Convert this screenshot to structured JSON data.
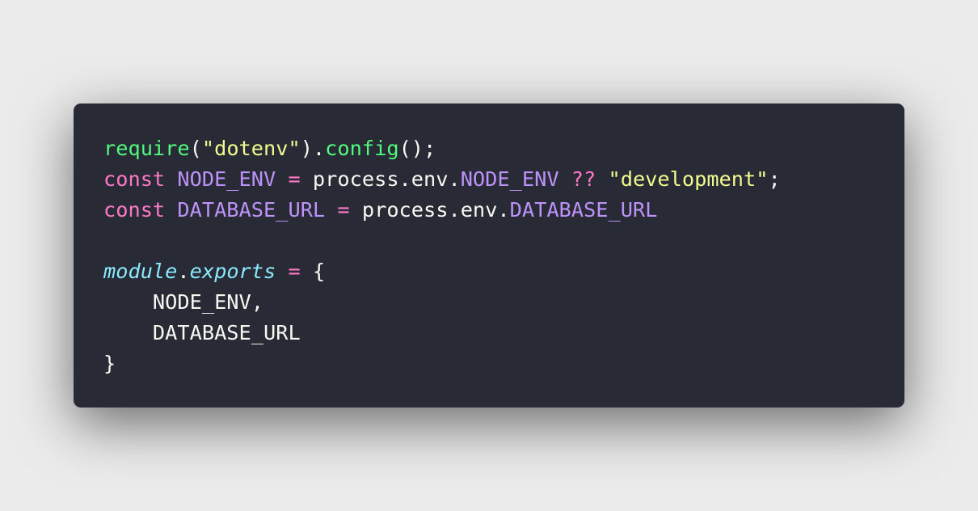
{
  "code": {
    "lines": [
      [
        {
          "text": "require",
          "kind": "fn"
        },
        {
          "text": "(",
          "kind": "plain"
        },
        {
          "text": "\"dotenv\"",
          "kind": "str"
        },
        {
          "text": ").",
          "kind": "plain"
        },
        {
          "text": "config",
          "kind": "fn"
        },
        {
          "text": "();",
          "kind": "plain"
        }
      ],
      [
        {
          "text": "const",
          "kind": "kw"
        },
        {
          "text": " ",
          "kind": "plain"
        },
        {
          "text": "NODE_ENV",
          "kind": "var"
        },
        {
          "text": " ",
          "kind": "plain"
        },
        {
          "text": "=",
          "kind": "kw"
        },
        {
          "text": " process.env.",
          "kind": "plain"
        },
        {
          "text": "NODE_ENV",
          "kind": "var"
        },
        {
          "text": " ",
          "kind": "plain"
        },
        {
          "text": "??",
          "kind": "kw"
        },
        {
          "text": " ",
          "kind": "plain"
        },
        {
          "text": "\"development\"",
          "kind": "str"
        },
        {
          "text": ";",
          "kind": "plain"
        }
      ],
      [
        {
          "text": "const",
          "kind": "kw"
        },
        {
          "text": " ",
          "kind": "plain"
        },
        {
          "text": "DATABASE_URL",
          "kind": "var"
        },
        {
          "text": " ",
          "kind": "plain"
        },
        {
          "text": "=",
          "kind": "kw"
        },
        {
          "text": " process.env.",
          "kind": "plain"
        },
        {
          "text": "DATABASE_URL",
          "kind": "var"
        }
      ],
      [],
      [
        {
          "text": "module",
          "kind": "italic-cyan"
        },
        {
          "text": ".",
          "kind": "plain"
        },
        {
          "text": "exports",
          "kind": "italic-cyan"
        },
        {
          "text": " ",
          "kind": "plain"
        },
        {
          "text": "=",
          "kind": "kw"
        },
        {
          "text": " {",
          "kind": "plain"
        }
      ],
      [
        {
          "text": "    NODE_ENV,",
          "kind": "plain"
        }
      ],
      [
        {
          "text": "    DATABASE_URL",
          "kind": "plain"
        }
      ],
      [
        {
          "text": "}",
          "kind": "plain"
        }
      ]
    ]
  },
  "colors": {
    "background": "#ebebeb",
    "editor_background": "#282a36",
    "function": "#50fa7b",
    "string": "#f1fa8c",
    "keyword": "#ff79c6",
    "constant": "#bd93f9",
    "plain": "#f8f8f2",
    "italic_identifier": "#8be9fd"
  }
}
